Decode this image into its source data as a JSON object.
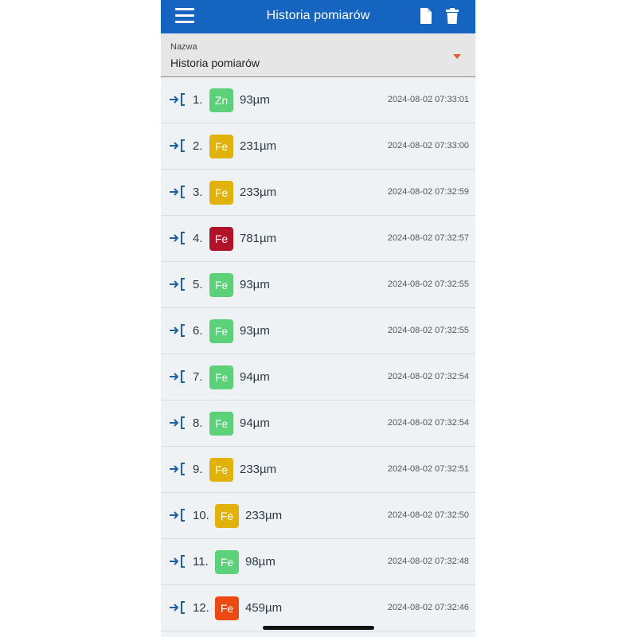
{
  "header": {
    "title": "Historia pomiarów"
  },
  "selector": {
    "label": "Nazwa",
    "value": "Historia pomiarów"
  },
  "colors": {
    "header_bg": "#1565c0",
    "status_green": "#5dd07a",
    "status_yellow": "#e2b20c",
    "status_red": "#b0122a",
    "status_orange": "#ec4a10",
    "icon_blue": "#1f5fa8",
    "dropdown_arrow": "#e4602f"
  },
  "measurements": [
    {
      "index": "1.",
      "material": "Zn",
      "status": "green",
      "value": "93µm",
      "time": "2024-08-02 07:33:01"
    },
    {
      "index": "2.",
      "material": "Fe",
      "status": "yellow",
      "value": "231µm",
      "time": "2024-08-02 07:33:00"
    },
    {
      "index": "3.",
      "material": "Fe",
      "status": "yellow",
      "value": "233µm",
      "time": "2024-08-02 07:32:59"
    },
    {
      "index": "4.",
      "material": "Fe",
      "status": "red",
      "value": "781µm",
      "time": "2024-08-02 07:32:57"
    },
    {
      "index": "5.",
      "material": "Fe",
      "status": "green",
      "value": "93µm",
      "time": "2024-08-02 07:32:55"
    },
    {
      "index": "6.",
      "material": "Fe",
      "status": "green",
      "value": "93µm",
      "time": "2024-08-02 07:32:55"
    },
    {
      "index": "7.",
      "material": "Fe",
      "status": "green",
      "value": "94µm",
      "time": "2024-08-02 07:32:54"
    },
    {
      "index": "8.",
      "material": "Fe",
      "status": "green",
      "value": "94µm",
      "time": "2024-08-02 07:32:54"
    },
    {
      "index": "9.",
      "material": "Fe",
      "status": "yellow",
      "value": "233µm",
      "time": "2024-08-02 07:32:51"
    },
    {
      "index": "10.",
      "material": "Fe",
      "status": "yellow",
      "value": "233µm",
      "time": "2024-08-02 07:32:50"
    },
    {
      "index": "11.",
      "material": "Fe",
      "status": "green",
      "value": "98µm",
      "time": "2024-08-02 07:32:48"
    },
    {
      "index": "12.",
      "material": "Fe",
      "status": "orange",
      "value": "459µm",
      "time": "2024-08-02 07:32:46"
    }
  ]
}
